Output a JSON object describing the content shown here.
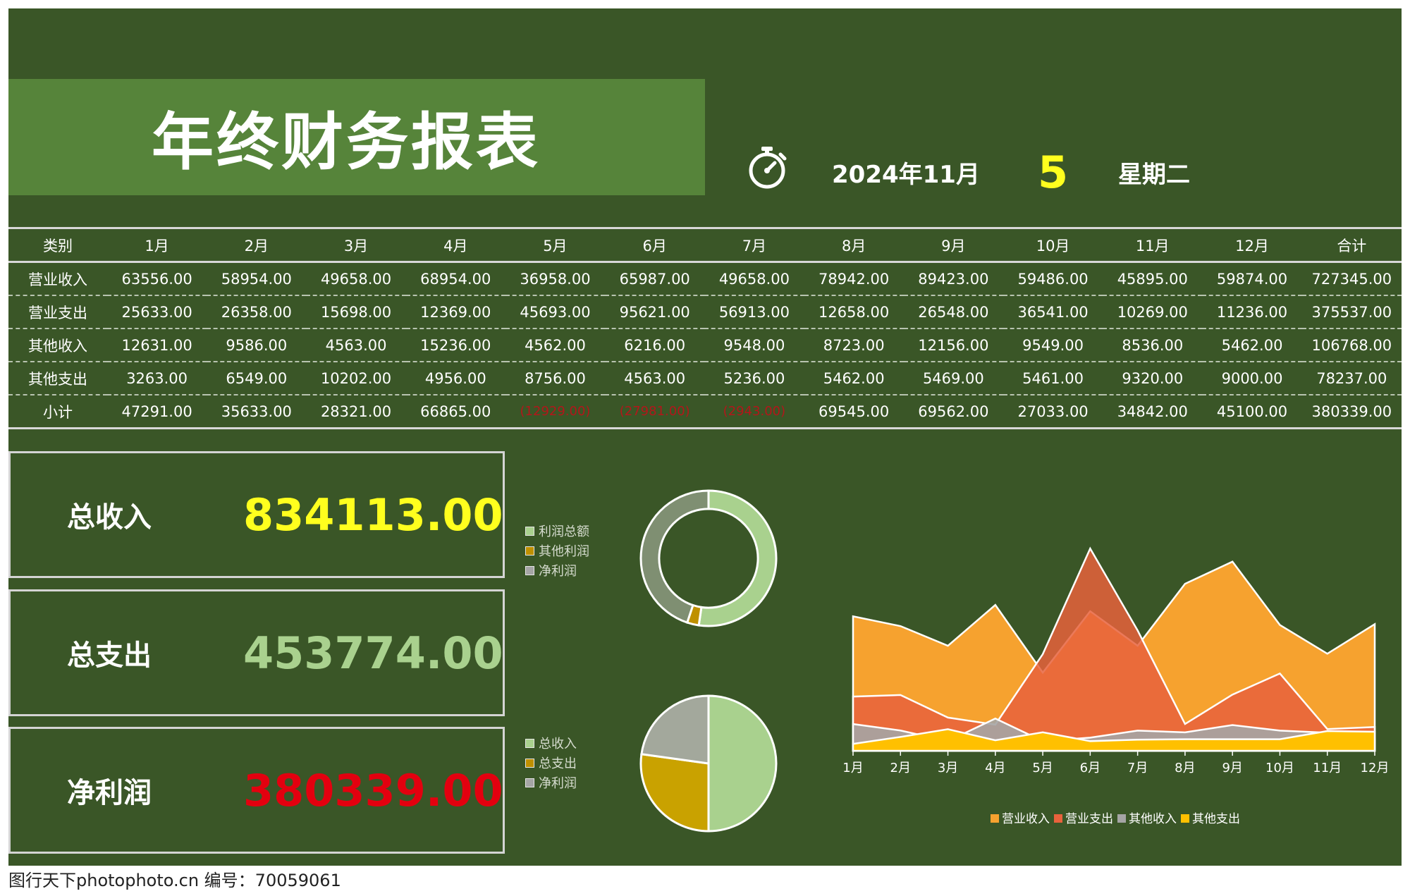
{
  "header": {
    "title": "年终财务报表",
    "date": "2024年11月",
    "day": "5",
    "weekday": "星期二",
    "timer_icon": "stopwatch-icon"
  },
  "table": {
    "columns": [
      "类别",
      "1月",
      "2月",
      "3月",
      "4月",
      "5月",
      "6月",
      "7月",
      "8月",
      "9月",
      "10月",
      "11月",
      "12月",
      "合计"
    ],
    "rows": [
      {
        "label": "营业收入",
        "cells": [
          "63556.00",
          "58954.00",
          "49658.00",
          "68954.00",
          "36958.00",
          "65987.00",
          "49658.00",
          "78942.00",
          "89423.00",
          "59486.00",
          "45895.00",
          "59874.00",
          "727345.00"
        ]
      },
      {
        "label": "营业支出",
        "cells": [
          "25633.00",
          "26358.00",
          "15698.00",
          "12369.00",
          "45693.00",
          "95621.00",
          "56913.00",
          "12658.00",
          "26548.00",
          "36541.00",
          "10269.00",
          "11236.00",
          "375537.00"
        ]
      },
      {
        "label": "其他收入",
        "cells": [
          "12631.00",
          "9586.00",
          "4563.00",
          "15236.00",
          "4562.00",
          "6216.00",
          "9548.00",
          "8723.00",
          "12156.00",
          "9549.00",
          "8536.00",
          "5462.00",
          "106768.00"
        ]
      },
      {
        "label": "其他支出",
        "cells": [
          "3263.00",
          "6549.00",
          "10202.00",
          "4956.00",
          "8756.00",
          "4563.00",
          "5236.00",
          "5462.00",
          "5469.00",
          "5461.00",
          "9320.00",
          "9000.00",
          "78237.00"
        ]
      },
      {
        "label": "小计",
        "cells": [
          "47291.00",
          "35633.00",
          "28321.00",
          "66865.00",
          "(12929.00)",
          "(27981.00)",
          "(2943.00)",
          "69545.00",
          "69562.00",
          "27033.00",
          "34842.00",
          "45100.00",
          "380339.00"
        ]
      }
    ]
  },
  "kpis": [
    {
      "label": "总收入",
      "value": "834113.00",
      "color": "#ffff1e"
    },
    {
      "label": "总支出",
      "value": "453774.00",
      "color": "#a9d18e"
    },
    {
      "label": "净利润",
      "value": "380339.00",
      "color": "#e3000f"
    }
  ],
  "colors": {
    "background": "#3a5627",
    "banner": "#56843a",
    "positive": "#ffffff",
    "negative": "#b3161a"
  },
  "watermark": "图行天下photophoto.cn 编号：70059061",
  "chart_data": [
    {
      "type": "pie",
      "variant": "donut",
      "legend": [
        "利润总额",
        "其他利润",
        "净利润"
      ],
      "legend_colors": [
        "#a9d18e",
        "#bf9000",
        "#a5a5a5"
      ],
      "values": [
        52.3,
        2.8,
        44.9
      ],
      "colors": [
        "#a9d18e",
        "#bf9000",
        "#7f8f72"
      ]
    },
    {
      "type": "pie",
      "legend": [
        "总收入",
        "总支出",
        "净利润"
      ],
      "legend_colors": [
        "#a9d18e",
        "#bf9000",
        "#a5a5a5"
      ],
      "values": [
        834113,
        453774,
        380339
      ],
      "colors": [
        "#a9d18e",
        "#c9a200",
        "#a3a89c"
      ]
    },
    {
      "type": "area",
      "categories": [
        "1月",
        "2月",
        "3月",
        "4月",
        "5月",
        "6月",
        "7月",
        "8月",
        "9月",
        "10月",
        "11月",
        "12月"
      ],
      "series": [
        {
          "name": "营业收入",
          "values": [
            63556,
            58954,
            49658,
            68954,
            36958,
            65987,
            49658,
            78942,
            89423,
            59486,
            45895,
            59874
          ],
          "color": "#f6a22f"
        },
        {
          "name": "营业支出",
          "values": [
            25633,
            26358,
            15698,
            12369,
            45693,
            95621,
            56913,
            12658,
            26548,
            36541,
            10269,
            11236
          ],
          "color": "#e8623c"
        },
        {
          "name": "其他收入",
          "values": [
            12631,
            9586,
            4563,
            15236,
            4562,
            6216,
            9548,
            8723,
            12156,
            9549,
            8536,
            5462
          ],
          "color": "#a5a5a5"
        },
        {
          "name": "其他支出",
          "values": [
            3263,
            6549,
            10202,
            4956,
            8756,
            4563,
            5236,
            5462,
            5469,
            5461,
            9320,
            9000
          ],
          "color": "#ffc000"
        }
      ],
      "ylim": [
        0,
        100000
      ],
      "legend_position": "bottom"
    }
  ]
}
